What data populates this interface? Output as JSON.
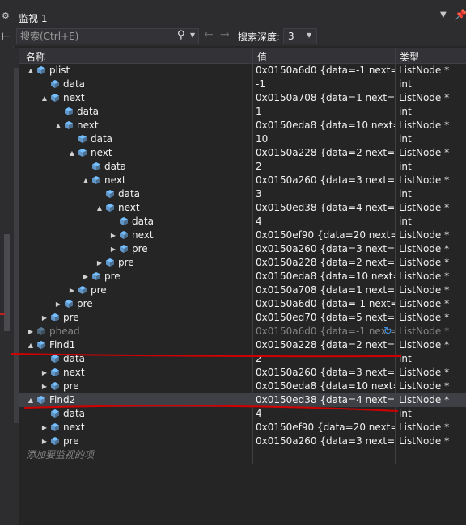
{
  "window": {
    "title": "监视 1",
    "side_icon_top": "⚙",
    "side_icon_bottom": "⊢"
  },
  "search": {
    "placeholder": "搜索(Ctrl+E)",
    "depth_label": "搜索深度:",
    "depth_value": "3"
  },
  "icons": {
    "search": "search-icon",
    "back": "arrow-left-icon",
    "forward": "arrow-right-icon",
    "pin": "pin-icon",
    "refresh": "refresh-icon",
    "variable": "cube-icon"
  },
  "colors": {
    "background": "#252526",
    "header": "#333337",
    "selection": "#3f3f46",
    "cube": "#75beff",
    "cube_dim": "#5a7a96",
    "annotation": "#d00000"
  },
  "columns": {
    "name": "名称",
    "value": "值",
    "type": "类型"
  },
  "add_watch": "添加要监视的项",
  "rows": [
    {
      "name": "plist",
      "value": "0x0150a6d0 {data=-1 next=0x0...",
      "type": "ListNode *",
      "level": 0,
      "expander": "▲"
    },
    {
      "name": "data",
      "value": "-1",
      "type": "int",
      "level": 1,
      "expander": ""
    },
    {
      "name": "next",
      "value": "0x0150a708 {data=1 next=0x01...",
      "type": "ListNode *",
      "level": 1,
      "expander": "▲"
    },
    {
      "name": "data",
      "value": "1",
      "type": "int",
      "level": 2,
      "expander": ""
    },
    {
      "name": "next",
      "value": "0x0150eda8 {data=10 next=0x...",
      "type": "ListNode *",
      "level": 2,
      "expander": "▲"
    },
    {
      "name": "data",
      "value": "10",
      "type": "int",
      "level": 3,
      "expander": ""
    },
    {
      "name": "next",
      "value": "0x0150a228 {data=2 next=0x01...",
      "type": "ListNode *",
      "level": 3,
      "expander": "▲"
    },
    {
      "name": "data",
      "value": "2",
      "type": "int",
      "level": 4,
      "expander": ""
    },
    {
      "name": "next",
      "value": "0x0150a260 {data=3 next=0x01...",
      "type": "ListNode *",
      "level": 4,
      "expander": "▲"
    },
    {
      "name": "data",
      "value": "3",
      "type": "int",
      "level": 5,
      "expander": ""
    },
    {
      "name": "next",
      "value": "0x0150ed38 {data=4 next=0x0...",
      "type": "ListNode *",
      "level": 5,
      "expander": "▲"
    },
    {
      "name": "data",
      "value": "4",
      "type": "int",
      "level": 6,
      "expander": ""
    },
    {
      "name": "next",
      "value": "0x0150ef90 {data=20 next=0x0...",
      "type": "ListNode *",
      "level": 6,
      "expander": "▶"
    },
    {
      "name": "pre",
      "value": "0x0150a260 {data=3 next=0x01...",
      "type": "ListNode *",
      "level": 6,
      "expander": "▶"
    },
    {
      "name": "pre",
      "value": "0x0150a228 {data=2 next=0x01...",
      "type": "ListNode *",
      "level": 5,
      "expander": "▶"
    },
    {
      "name": "pre",
      "value": "0x0150eda8 {data=10 next=0x...",
      "type": "ListNode *",
      "level": 4,
      "expander": "▶"
    },
    {
      "name": "pre",
      "value": "0x0150a708 {data=1 next=0x01...",
      "type": "ListNode *",
      "level": 3,
      "expander": "▶"
    },
    {
      "name": "pre",
      "value": "0x0150a6d0 {data=-1 next=0x0...",
      "type": "ListNode *",
      "level": 2,
      "expander": "▶"
    },
    {
      "name": "pre",
      "value": "0x0150ed70 {data=5 next=0x0...",
      "type": "ListNode *",
      "level": 1,
      "expander": "▶"
    },
    {
      "name": "phead",
      "value": "0x0150a6d0 {data=-1 next=...",
      "type": "ListNode *",
      "level": 0,
      "expander": "▶",
      "stale": true
    },
    {
      "name": "Find1",
      "value": "0x0150a228 {data=2 next=0x01...",
      "type": "ListNode *",
      "level": 0,
      "expander": "▲"
    },
    {
      "name": "data",
      "value": "2",
      "type": "int",
      "level": 1,
      "expander": ""
    },
    {
      "name": "next",
      "value": "0x0150a260 {data=3 next=0x01...",
      "type": "ListNode *",
      "level": 1,
      "expander": "▶"
    },
    {
      "name": "pre",
      "value": "0x0150eda8 {data=10 next=0x...",
      "type": "ListNode *",
      "level": 1,
      "expander": "▶"
    },
    {
      "name": "Find2",
      "value": "0x0150ed38 {data=4 next=0x0...",
      "type": "ListNode *",
      "level": 0,
      "expander": "▲",
      "selected": true
    },
    {
      "name": "data",
      "value": "4",
      "type": "int",
      "level": 1,
      "expander": ""
    },
    {
      "name": "next",
      "value": "0x0150ef90 {data=20 next=0x0...",
      "type": "ListNode *",
      "level": 1,
      "expander": "▶"
    },
    {
      "name": "pre",
      "value": "0x0150a260 {data=3 next=0x01...",
      "type": "ListNode *",
      "level": 1,
      "expander": "▶"
    }
  ]
}
